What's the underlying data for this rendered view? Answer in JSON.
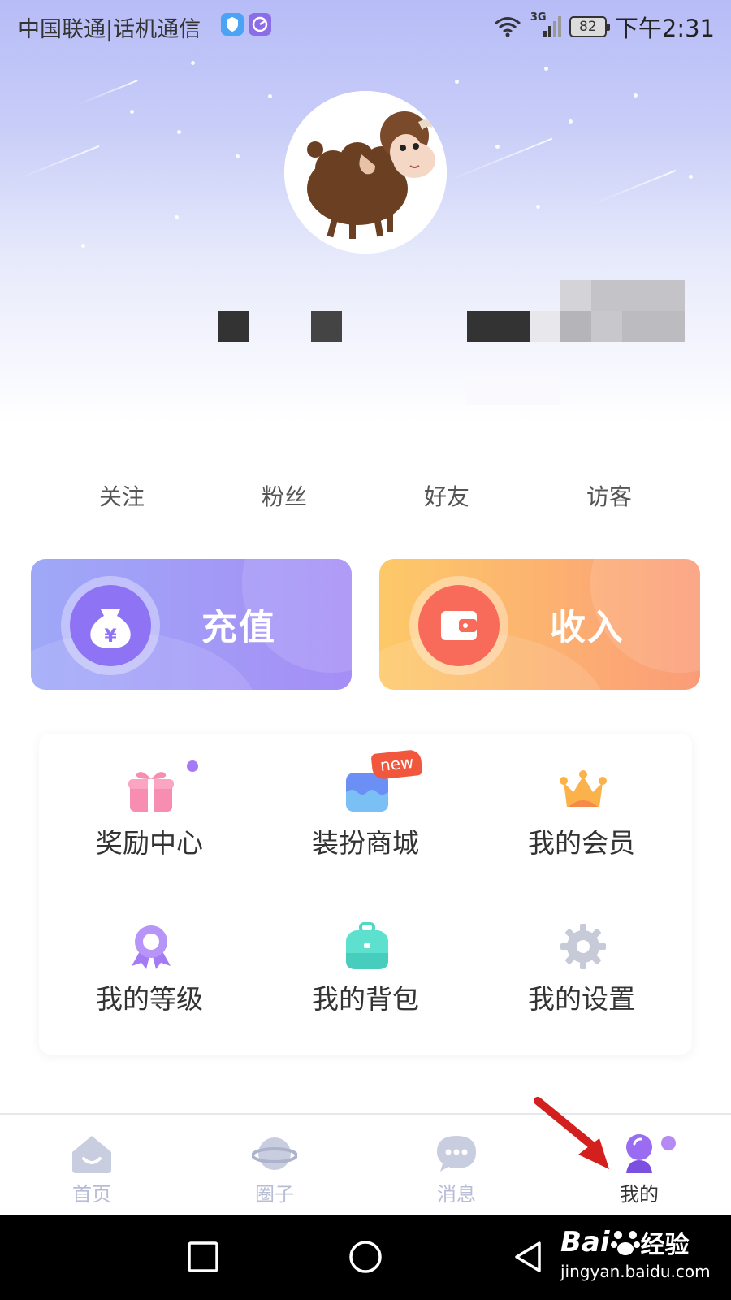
{
  "status_bar": {
    "carrier": "中国联通|话机通信",
    "network": "3G",
    "battery": "82",
    "time": "下午2:31"
  },
  "profile": {
    "avatar_icon": "sheep-avatar-icon"
  },
  "stats": [
    {
      "label": "关注"
    },
    {
      "label": "粉丝"
    },
    {
      "label": "好友"
    },
    {
      "label": "访客"
    }
  ],
  "actions": {
    "recharge_label": "充值",
    "recharge_symbol": "¥",
    "income_label": "收入"
  },
  "grid": [
    {
      "label": "奖励中心",
      "icon": "gift-icon",
      "dot": true
    },
    {
      "label": "装扮商城",
      "icon": "shop-icon",
      "badge": "new"
    },
    {
      "label": "我的会员",
      "icon": "crown-icon"
    },
    {
      "label": "我的等级",
      "icon": "medal-icon"
    },
    {
      "label": "我的背包",
      "icon": "backpack-icon"
    },
    {
      "label": "我的设置",
      "icon": "gear-icon"
    }
  ],
  "tabbar": [
    {
      "label": "首页",
      "icon": "home-icon",
      "active": false
    },
    {
      "label": "圈子",
      "icon": "planet-icon",
      "active": false
    },
    {
      "label": "消息",
      "icon": "chat-icon",
      "active": false
    },
    {
      "label": "我的",
      "icon": "profile-icon",
      "active": true
    }
  ],
  "watermark": {
    "brand": "Bai",
    "brand_suffix": "经验",
    "url": "jingyan.baidu.com"
  },
  "colors": {
    "accent_purple": "#8f73f5",
    "accent_orange": "#fa8a6a",
    "header_bg": "#b7bcf7"
  }
}
